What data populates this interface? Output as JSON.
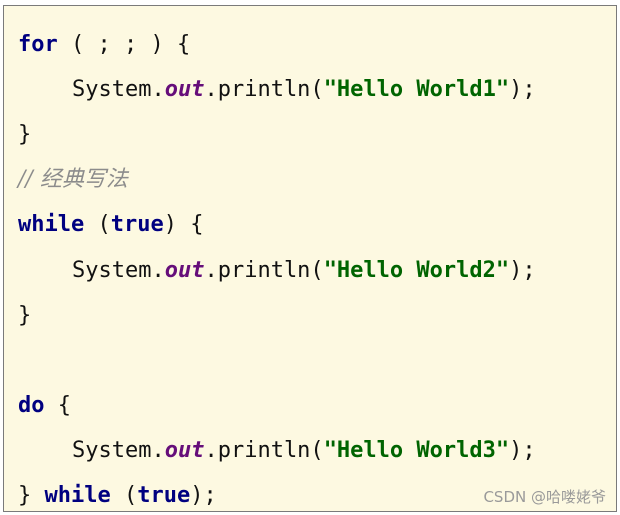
{
  "code": {
    "line1": {
      "kw": "for",
      "rest": " ( ; ; ) {"
    },
    "line2": {
      "prefix": "System.",
      "field": "out",
      "middle": ".println(",
      "str": "\"Hello World1\"",
      "end": ");"
    },
    "line3": {
      "text": "}"
    },
    "line4": {
      "comment": "// 经典写法"
    },
    "line5": {
      "kw1": "while",
      "p1": " (",
      "kw2": "true",
      "p2": ") {"
    },
    "line6": {
      "prefix": "System.",
      "field": "out",
      "middle": ".println(",
      "str": "\"Hello World2\"",
      "end": ");"
    },
    "line7": {
      "text": "}"
    },
    "line9": {
      "kw": "do",
      "rest": " {"
    },
    "line10": {
      "prefix": "System.",
      "field": "out",
      "middle": ".println(",
      "str": "\"Hello World3\"",
      "end": ");"
    },
    "line11": {
      "brace": "} ",
      "kw1": "while",
      "p1": " (",
      "kw2": "true",
      "p2": ");"
    }
  },
  "watermark": "CSDN @哈喽姥爷"
}
